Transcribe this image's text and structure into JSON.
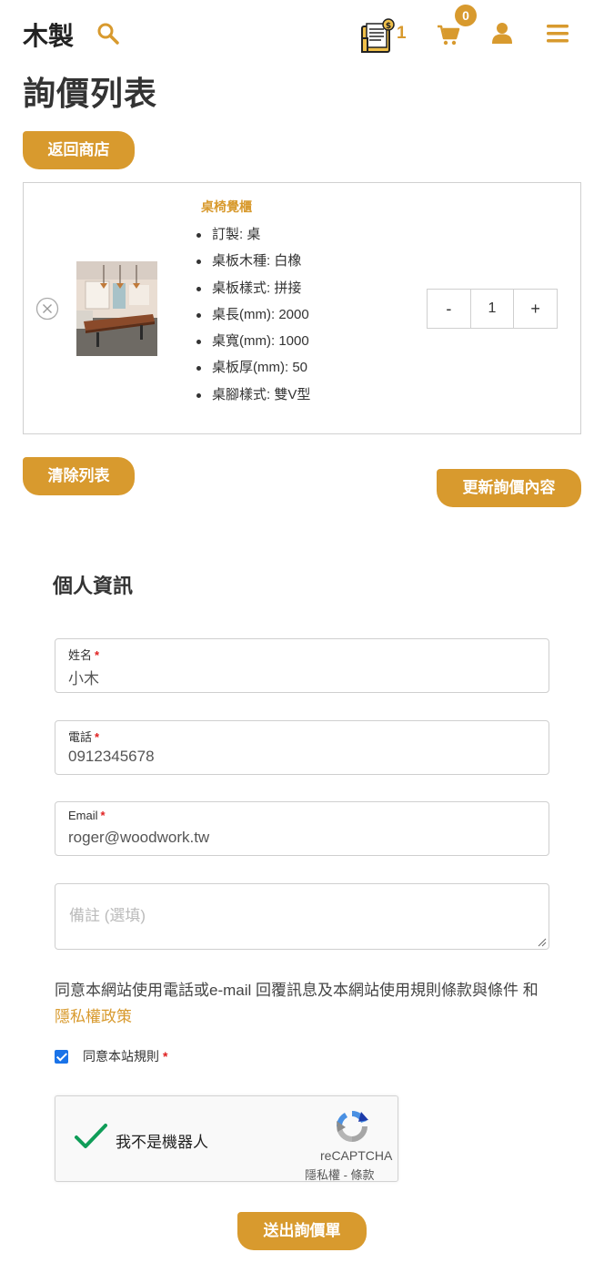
{
  "header": {
    "logo": "木製",
    "inquiry_count": "1",
    "cart_count": "0"
  },
  "page": {
    "title": "詢價列表",
    "back_button": "返回商店"
  },
  "item": {
    "name": "桌椅覺櫃",
    "specs": [
      {
        "key": "訂製",
        "value": "桌"
      },
      {
        "key": "桌板木種",
        "value": "白橡"
      },
      {
        "key": "桌板樣式",
        "value": "拼接"
      },
      {
        "key": "桌長(mm)",
        "value": "2000"
      },
      {
        "key": "桌寬(mm)",
        "value": "1000"
      },
      {
        "key": "桌板厚(mm)",
        "value": "50"
      },
      {
        "key": "桌腳樣式",
        "value": "雙V型"
      }
    ],
    "qty_minus": "-",
    "qty_value": "1",
    "qty_plus": "+"
  },
  "actions": {
    "clear": "清除列表",
    "update": "更新詢價內容"
  },
  "form": {
    "section_title": "個人資訊",
    "name_label": "姓名",
    "name_value": "小木",
    "phone_label": "電話",
    "phone_value": "0912345678",
    "email_label": "Email",
    "email_value": "roger@woodwork.tw",
    "note_placeholder": "備註 (選填)",
    "required_mark": "*",
    "consent_text": "同意本網站使用電話或e-mail 回覆訊息及本網站使用規則條款與條件 和 ",
    "privacy_link": "隱私權政策",
    "agree_label": "同意本站規則",
    "agree_checked": true,
    "submit": "送出詢價單"
  },
  "recaptcha": {
    "label": "我不是機器人",
    "brand": "reCAPTCHA",
    "terms": "隱私權 - 條款"
  },
  "colors": {
    "accent": "#d89a2e",
    "required": "#e02020",
    "checkbox": "#1a73e8"
  }
}
